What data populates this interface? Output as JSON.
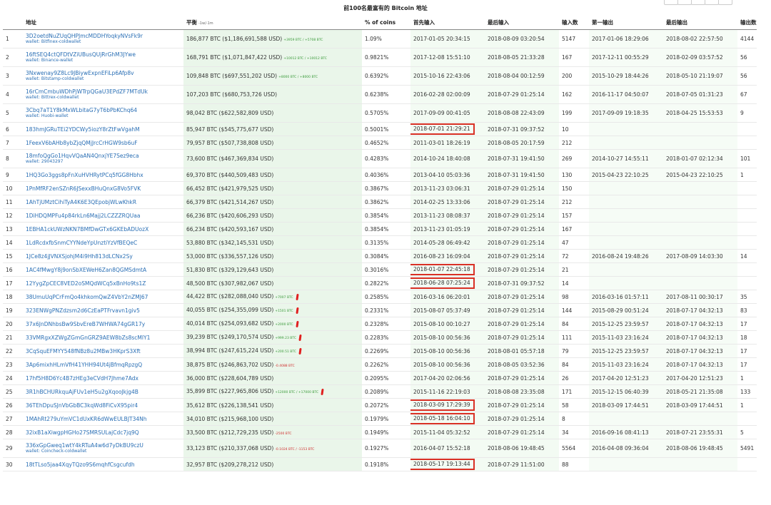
{
  "page_title": "前100名最富有的 Bitcoin 地址",
  "headers": {
    "num": "",
    "address": "地址",
    "balance": "平衡",
    "balance_sort": "-1w/-1m",
    "pct": "% of coins",
    "first_in": "首先输入",
    "last_in": "最后输入",
    "ins": "输入数",
    "first_out": "第一输出",
    "last_out": "最后输出",
    "outs": "输出数"
  },
  "rows": [
    {
      "n": "1",
      "addr": "3D2oetdNuZUqQHPJmcMDDHYoqkyNVsFk9r",
      "wallet": "wallet: Bitfinex-coldwallet",
      "bal": "186,877 BTC ($1,186,691,588 USD)",
      "chg": "+3959 BTC / +5708 BTC",
      "chg_type": "pos",
      "pct": "1.09%",
      "fi": "2017-01-05 20:34:15",
      "li": "2018-08-09 03:20:54",
      "ins": "5147",
      "fo": "2017-01-06 18:29:06",
      "lo": "2018-08-02 22:57:50",
      "outs": "4144",
      "hl": false,
      "mark": false
    },
    {
      "n": "2",
      "addr": "16ftSEQ4ctQFDtVZiUBusQUjRrGhM3JYwe",
      "wallet": "wallet: Binance-wallet",
      "bal": "168,791 BTC ($1,071,847,422 USD)",
      "chg": "+10012 BTC / +10012 BTC",
      "chg_type": "pos",
      "pct": "0.9821%",
      "fi": "2017-12-08 15:51:10",
      "li": "2018-08-05 21:33:28",
      "ins": "167",
      "fo": "2017-12-11 00:55:29",
      "lo": "2018-02-09 03:57:52",
      "outs": "56",
      "hl": false,
      "mark": false
    },
    {
      "n": "3",
      "addr": "3Nxwenay9Z8Lc9JBiywExpnEFiLp6Afp8v",
      "wallet": "wallet: Bitstamp-coldwallet",
      "bal": "109,848 BTC ($697,551,202 USD)",
      "chg": "+8000 BTC / +8000 BTC",
      "chg_type": "pos",
      "pct": "0.6392%",
      "fi": "2015-10-16 22:43:06",
      "li": "2018-08-04 00:12:59",
      "ins": "200",
      "fo": "2015-10-29 18:44:26",
      "lo": "2018-05-10 21:19:07",
      "outs": "56",
      "hl": false,
      "mark": false
    },
    {
      "n": "4",
      "addr": "16rCmCmbuWDhPjWTrpQGaU3EPdZF7MTdUk",
      "wallet": "wallet: Bittrex-coldwallet",
      "bal": "107,203 BTC ($680,753,726 USD)",
      "chg": "",
      "chg_type": "",
      "pct": "0.6238%",
      "fi": "2016-02-28 02:00:09",
      "li": "2018-07-29 01:25:14",
      "ins": "162",
      "fo": "2016-11-17 04:50:07",
      "lo": "2018-07-05 01:31:23",
      "outs": "67",
      "hl": false,
      "mark": false
    },
    {
      "n": "5",
      "addr": "3Cbq7aT1Y8kMxWLbitaG7yT6bPbKChq64",
      "wallet": "wallet: Huobi-wallet",
      "bal": "98,042 BTC ($622,582,809 USD)",
      "chg": "",
      "chg_type": "",
      "pct": "0.5705%",
      "fi": "2017-09-09 00:41:05",
      "li": "2018-08-08 22:43:09",
      "ins": "199",
      "fo": "2017-09-09 19:18:35",
      "lo": "2018-04-25 15:53:53",
      "outs": "9",
      "hl": false,
      "mark": false
    },
    {
      "n": "6",
      "addr": "183hmJGRuTEi2YDCWy5iozY8rZtFwVgahM",
      "wallet": "",
      "bal": "85,947 BTC ($545,775,677 USD)",
      "chg": "",
      "chg_type": "",
      "pct": "0.5001%",
      "fi": "2018-07-01 21:29:21",
      "li": "2018-07-31 09:37:52",
      "ins": "10",
      "fo": "",
      "lo": "",
      "outs": "",
      "hl": true,
      "mark": false
    },
    {
      "n": "7",
      "addr": "1FeexV6bAHb8ybZjqQMjJrcCrHGW9sb6uF",
      "wallet": "",
      "bal": "79,957 BTC ($507,738,808 USD)",
      "chg": "",
      "chg_type": "",
      "pct": "0.4652%",
      "fi": "2011-03-01 18:26:19",
      "li": "2018-08-05 20:17:59",
      "ins": "212",
      "fo": "",
      "lo": "",
      "outs": "",
      "hl": false,
      "mark": false
    },
    {
      "n": "8",
      "addr": "18mfoQgGo1HqvVQaAN4QnxjYE7Sez9eca",
      "wallet": "wallet: 29043297",
      "bal": "73,600 BTC ($467,369,834 USD)",
      "chg": "",
      "chg_type": "",
      "pct": "0.4283%",
      "fi": "2014-10-24 18:40:08",
      "li": "2018-07-31 19:41:50",
      "ins": "269",
      "fo": "2014-10-27 14:55:11",
      "lo": "2018-01-07 02:12:34",
      "outs": "101",
      "hl": false,
      "mark": false
    },
    {
      "n": "9",
      "addr": "1HQ3Go3ggs8pFnXuHVHRytPCq5fGG8Hbhx",
      "wallet": "",
      "bal": "69,370 BTC ($440,509,483 USD)",
      "chg": "",
      "chg_type": "",
      "pct": "0.4036%",
      "fi": "2013-04-10 05:03:36",
      "li": "2018-07-31 19:41:50",
      "ins": "130",
      "fo": "2015-04-23 22:10:25",
      "lo": "2015-04-23 22:10:25",
      "outs": "1",
      "hl": false,
      "mark": false
    },
    {
      "n": "10",
      "addr": "1PnMfRF2enSZnR6JSexxBHuQnxG8Vo5FVK",
      "wallet": "",
      "bal": "66,452 BTC ($421,979,525 USD)",
      "chg": "",
      "chg_type": "",
      "pct": "0.3867%",
      "fi": "2013-11-23 03:06:31",
      "li": "2018-07-29 01:25:14",
      "ins": "150",
      "fo": "",
      "lo": "",
      "outs": "",
      "hl": false,
      "mark": false
    },
    {
      "n": "11",
      "addr": "1AhTjUMztCihiTyA4K6E3QEpobjWLwKhkR",
      "wallet": "",
      "bal": "66,379 BTC ($421,514,267 USD)",
      "chg": "",
      "chg_type": "",
      "pct": "0.3862%",
      "fi": "2014-02-25 13:33:06",
      "li": "2018-07-29 01:25:14",
      "ins": "212",
      "fo": "",
      "lo": "",
      "outs": "",
      "hl": false,
      "mark": false
    },
    {
      "n": "12",
      "addr": "1DiHDQMPFu4p84rkLn6Majj2LCZZZRQUaa",
      "wallet": "",
      "bal": "66,236 BTC ($420,606,293 USD)",
      "chg": "",
      "chg_type": "",
      "pct": "0.3854%",
      "fi": "2013-11-23 08:08:37",
      "li": "2018-07-29 01:25:14",
      "ins": "157",
      "fo": "",
      "lo": "",
      "outs": "",
      "hl": false,
      "mark": false
    },
    {
      "n": "13",
      "addr": "1EBHA1ckUWzNKN7BMfDwGTx6GKEbADUozX",
      "wallet": "",
      "bal": "66,234 BTC ($420,593,167 USD)",
      "chg": "",
      "chg_type": "",
      "pct": "0.3854%",
      "fi": "2013-11-23 01:05:19",
      "li": "2018-07-29 01:25:14",
      "ins": "167",
      "fo": "",
      "lo": "",
      "outs": "",
      "hl": false,
      "mark": false
    },
    {
      "n": "14",
      "addr": "1LdRcdxfbSnmCYYNdeYpUnztiYzVfBEQeC",
      "wallet": "",
      "bal": "53,880 BTC ($342,145,531 USD)",
      "chg": "",
      "chg_type": "",
      "pct": "0.3135%",
      "fi": "2014-05-28 06:49:42",
      "li": "2018-07-29 01:25:14",
      "ins": "47",
      "fo": "",
      "lo": "",
      "outs": "",
      "hl": false,
      "mark": false
    },
    {
      "n": "15",
      "addr": "1JCe8z4jJVNXSjohjM4i9Hh813dLCNx2Sy",
      "wallet": "",
      "bal": "53,000 BTC ($336,557,126 USD)",
      "chg": "",
      "chg_type": "",
      "pct": "0.3084%",
      "fi": "2016-08-23 16:09:04",
      "li": "2018-07-29 01:25:14",
      "ins": "72",
      "fo": "2016-08-24 19:48:26",
      "lo": "2017-08-09 14:03:30",
      "outs": "14",
      "hl": false,
      "mark": false
    },
    {
      "n": "16",
      "addr": "1AC4fMwgY8j9onSbXEWeH6Zan8QGMSdmtA",
      "wallet": "",
      "bal": "51,830 BTC ($329,129,643 USD)",
      "chg": "",
      "chg_type": "",
      "pct": "0.3016%",
      "fi": "2018-01-07 22:45:18",
      "li": "2018-07-29 01:25:14",
      "ins": "21",
      "fo": "",
      "lo": "",
      "outs": "",
      "hl": true,
      "mark": false
    },
    {
      "n": "17",
      "addr": "12YygZpCEC8VED2oSMQdWCq5xBnHo9ts1Z",
      "wallet": "",
      "bal": "48,500 BTC ($307,982,067 USD)",
      "chg": "",
      "chg_type": "",
      "pct": "0.2822%",
      "fi": "2018-06-28 07:25:24",
      "li": "2018-07-31 09:37:52",
      "ins": "14",
      "fo": "",
      "lo": "",
      "outs": "",
      "hl": true,
      "mark": false
    },
    {
      "n": "18",
      "addr": "38UmuUqPCrFmQo4khkomQwZ4VbY2nZMJ67",
      "wallet": "",
      "bal": "44,422 BTC ($282,088,040 USD)",
      "chg": "+7007 BTC",
      "chg_type": "pos",
      "pct": "0.2585%",
      "fi": "2016-03-16 06:20:01",
      "li": "2018-07-29 01:25:14",
      "ins": "98",
      "fo": "2016-03-16 01:57:11",
      "lo": "2017-08-11 00:30:17",
      "outs": "35",
      "hl": false,
      "mark": true
    },
    {
      "n": "19",
      "addr": "323ENWgPNZdzsm2d6CzEaPTFrvavn1giv5",
      "wallet": "",
      "bal": "40,055 BTC ($254,355,099 USD)",
      "chg": "+1501 BTC",
      "chg_type": "pos",
      "pct": "0.2331%",
      "fi": "2015-08-07 05:37:49",
      "li": "2018-07-29 01:25:14",
      "ins": "144",
      "fo": "2015-08-29 00:51:24",
      "lo": "2018-07-17 04:32:13",
      "outs": "83",
      "hl": false,
      "mark": true
    },
    {
      "n": "20",
      "addr": "37x6JnDNhbsBw9SbvEreB7WHWA74gGR17y",
      "wallet": "",
      "bal": "40,014 BTC ($254,093,682 USD)",
      "chg": "+2000 BTC",
      "chg_type": "pos",
      "pct": "0.2328%",
      "fi": "2015-08-10 00:10:27",
      "li": "2018-07-29 01:25:14",
      "ins": "84",
      "fo": "2015-12-25 23:59:57",
      "lo": "2018-07-17 04:32:13",
      "outs": "17",
      "hl": false,
      "mark": true
    },
    {
      "n": "21",
      "addr": "33VMRgxXZWgZGmGnGRZ9AEW8bZs8scMlY1",
      "wallet": "",
      "bal": "39,239 BTC ($249,170,574 USD)",
      "chg": "+999.23 BTC",
      "chg_type": "pos",
      "pct": "0.2283%",
      "fi": "2015-08-10 00:56:36",
      "li": "2018-07-29 01:25:14",
      "ins": "111",
      "fo": "2015-11-03 23:16:24",
      "lo": "2018-07-17 04:32:13",
      "outs": "18",
      "hl": false,
      "mark": true
    },
    {
      "n": "22",
      "addr": "3CqSquEFMYY548fNBz8u2MBw3HKprS3Xft",
      "wallet": "",
      "bal": "38,994 BTC ($247,615,224 USD)",
      "chg": "+200.51 BTC",
      "chg_type": "pos",
      "pct": "0.2269%",
      "fi": "2015-08-10 00:56:36",
      "li": "2018-08-01 05:57:18",
      "ins": "79",
      "fo": "2015-12-25 23:59:57",
      "lo": "2018-07-17 04:32:13",
      "outs": "17",
      "hl": false,
      "mark": true
    },
    {
      "n": "23",
      "addr": "3Ap6mixhHLmVfH41YHH94Ut4jBfmqRpzgQ",
      "wallet": "",
      "bal": "38,875 BTC ($246,863,702 USD)",
      "chg": "-0.4088 BTC",
      "chg_type": "neg",
      "pct": "0.2262%",
      "fi": "2015-08-10 00:56:36",
      "li": "2018-08-05 03:52:36",
      "ins": "84",
      "fo": "2015-11-03 23:16:24",
      "lo": "2018-07-17 04:32:13",
      "outs": "17",
      "hl": false,
      "mark": false
    },
    {
      "n": "24",
      "addr": "17hf5H8D6Yc4B7zHEg3eCVdH7Jhme7Adx",
      "wallet": "",
      "bal": "36,000 BTC ($228,604,789 USD)",
      "chg": "",
      "chg_type": "",
      "pct": "0.2095%",
      "fi": "2017-04-20 02:06:56",
      "li": "2018-07-29 01:25:14",
      "ins": "26",
      "fo": "2017-04-20 12:51:23",
      "lo": "2017-04-20 12:51:23",
      "outs": "1",
      "hl": false,
      "mark": false
    },
    {
      "n": "25",
      "addr": "3R1hBCHURkquAjFUv1eH5u2gXqooJkjg4B",
      "wallet": "",
      "bal": "35,899 BTC ($227,965,806 USD)",
      "chg": "+12000 BTC / +17000 BTC",
      "chg_type": "pos",
      "pct": "0.2089%",
      "fi": "2015-11-16 22:19:03",
      "li": "2018-08-08 23:35:08",
      "ins": "171",
      "fo": "2015-12-15 06:40:39",
      "lo": "2018-05-21 21:35:08",
      "outs": "133",
      "hl": false,
      "mark": true
    },
    {
      "n": "26",
      "addr": "36TEhDpuSJnVbGbBC3kqWd8FiCvX95pir4",
      "wallet": "",
      "bal": "35,612 BTC ($226,138,541 USD)",
      "chg": "",
      "chg_type": "",
      "pct": "0.2072%",
      "fi": "2018-03-09 17:29:39",
      "li": "2018-07-29 01:25:14",
      "ins": "58",
      "fo": "2018-03-09 17:44:51",
      "lo": "2018-03-09 17:44:51",
      "outs": "1",
      "hl": true,
      "mark": false
    },
    {
      "n": "27",
      "addr": "1MAhRt279uYmVC1dUxKR6dWwEULBJT34Nh",
      "wallet": "",
      "bal": "34,010 BTC ($215,968,100 USD)",
      "chg": "",
      "chg_type": "",
      "pct": "0.1979%",
      "fi": "2018-05-18 16:04:10",
      "li": "2018-07-29 01:25:14",
      "ins": "8",
      "fo": "",
      "lo": "",
      "outs": "",
      "hl": true,
      "mark": false
    },
    {
      "n": "28",
      "addr": "32ixB1aXiwgpHGHo27SMRSULajCdc7jq9Q",
      "wallet": "",
      "bal": "33,500 BTC ($212,729,235 USD)",
      "chg": "-2500 BTC",
      "chg_type": "neg",
      "pct": "0.1949%",
      "fi": "2015-11-04 05:32:52",
      "li": "2018-07-29 01:25:14",
      "ins": "34",
      "fo": "2016-09-16 08:41:13",
      "lo": "2018-07-21 23:55:31",
      "outs": "5",
      "hl": false,
      "mark": false
    },
    {
      "n": "29",
      "addr": "336xGpGweq1wtY4kRTuA4w6d7yDkBU9czU",
      "wallet": "wallet: Coincheck-coldwallet",
      "bal": "33,123 BTC ($210,337,068 USD)",
      "chg": "-0.1024 BTC / -1153 BTC",
      "chg_type": "neg",
      "pct": "0.1927%",
      "fi": "2016-04-07 15:52:18",
      "li": "2018-08-06 19:48:45",
      "ins": "5564",
      "fo": "2016-04-08 09:36:04",
      "lo": "2018-08-06 19:48:45",
      "outs": "5491",
      "hl": false,
      "mark": false
    },
    {
      "n": "30",
      "addr": "18tTLso5jaa4XqyTQzo9S6mqhfCsgcufdh",
      "wallet": "",
      "bal": "32,957 BTC ($209,278,212 USD)",
      "chg": "",
      "chg_type": "",
      "pct": "0.1918%",
      "fi": "2018-05-17 19:13:44",
      "li": "2018-07-29 11:51:00",
      "ins": "88",
      "fo": "",
      "lo": "",
      "outs": "",
      "hl": true,
      "mark": false
    }
  ]
}
